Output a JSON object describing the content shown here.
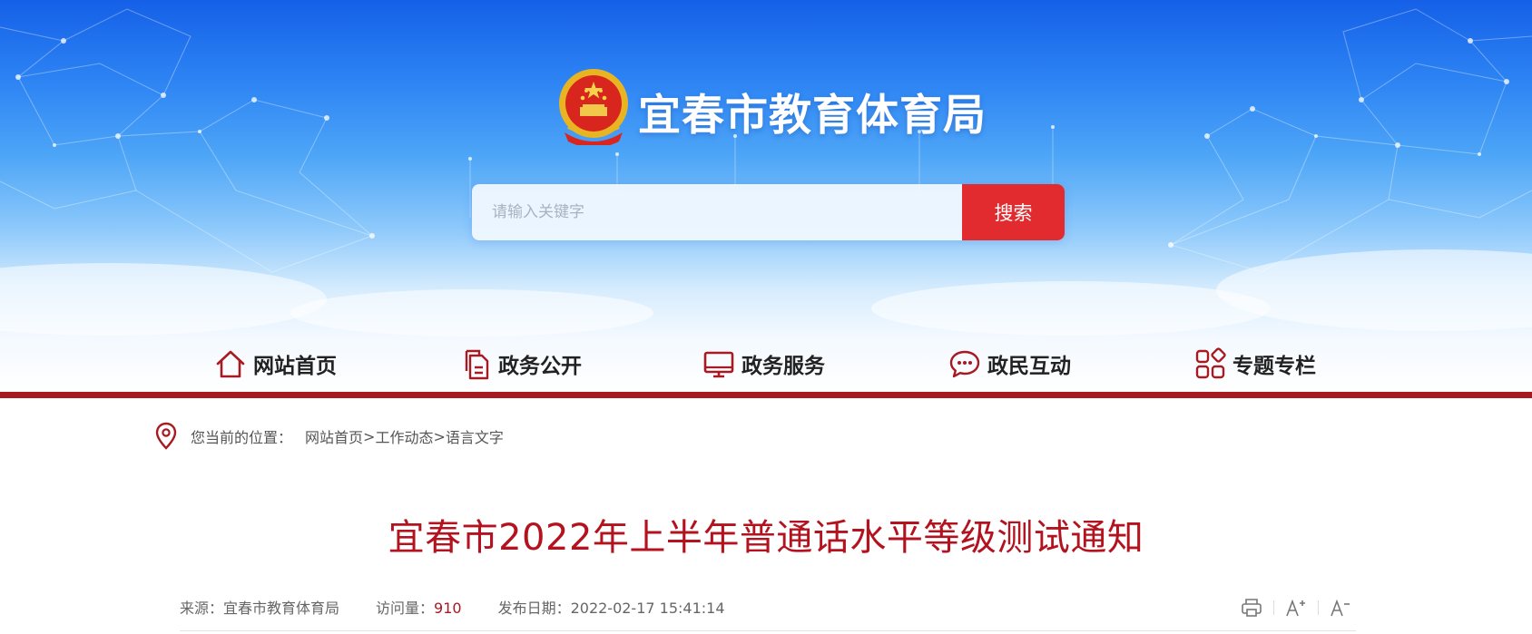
{
  "header": {
    "site_title": "宜春市教育体育局",
    "search": {
      "placeholder": "请输入关键字",
      "button_label": "搜索"
    }
  },
  "nav": {
    "items": [
      {
        "label": "网站首页",
        "icon": "home-icon"
      },
      {
        "label": "政务公开",
        "icon": "document-icon"
      },
      {
        "label": "政务服务",
        "icon": "monitor-icon"
      },
      {
        "label": "政民互动",
        "icon": "chat-bubble-icon"
      },
      {
        "label": "专题专栏",
        "icon": "grid-icon"
      }
    ]
  },
  "breadcrumb": {
    "label": "您当前的位置：",
    "items": [
      "网站首页",
      "工作动态",
      "语言文字"
    ],
    "separator": ">"
  },
  "article": {
    "title": "宜春市2022年上半年普通话水平等级测试通知",
    "source": "来源：宜春市教育体育局",
    "views_label": "访问量：",
    "views": "910",
    "date": "发布日期：2022-02-17 15:41:14"
  },
  "tools": [
    "print-icon",
    "font-increase-icon",
    "font-decrease-icon"
  ],
  "colors": {
    "brand_red": "#a81a22",
    "search_red": "#e12b2f",
    "title_red": "#b3131f",
    "header_blue": "#2f86f4"
  }
}
